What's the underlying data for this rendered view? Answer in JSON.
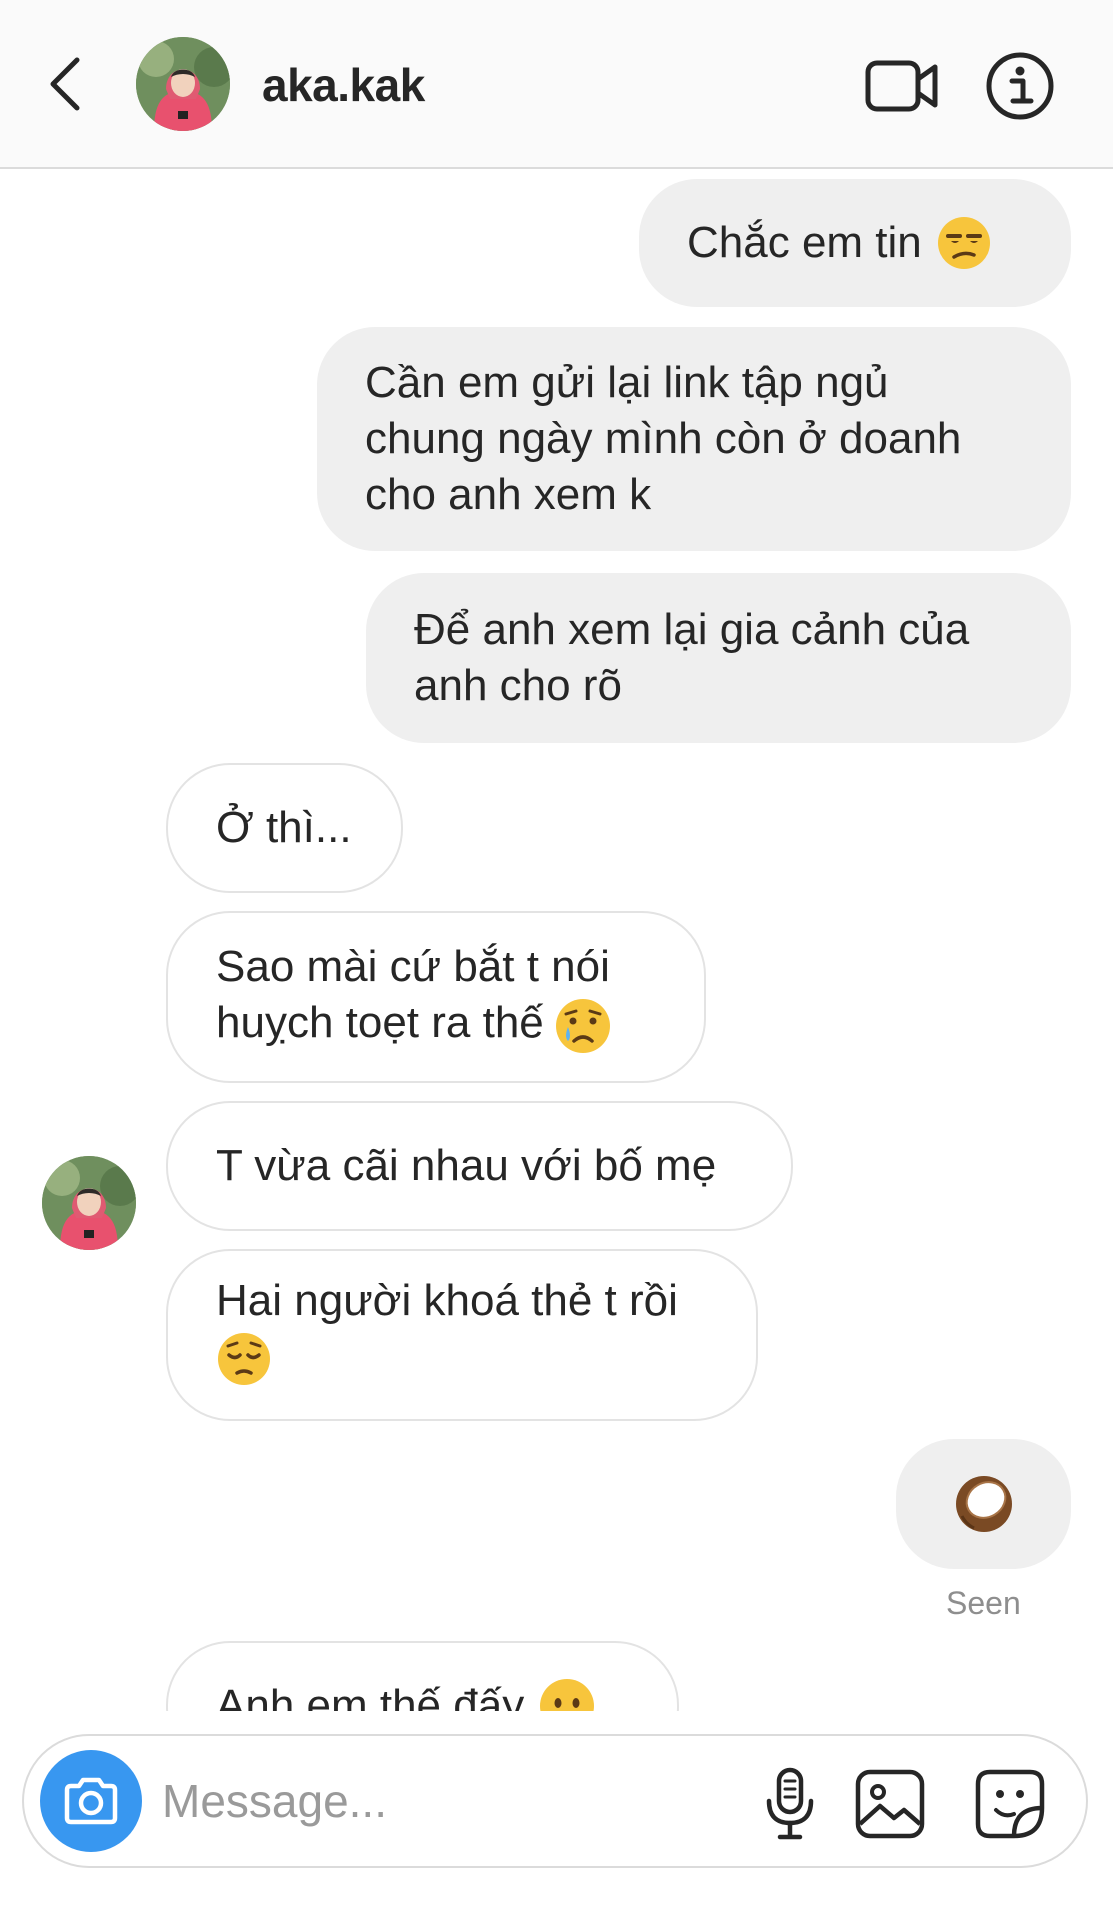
{
  "header": {
    "username": "aka.kak",
    "icons": {
      "back": "chevron-left-icon",
      "video": "video-camera-icon",
      "info": "info-icon"
    }
  },
  "messages": [
    {
      "direction": "outgoing",
      "text": "Chắc em tin",
      "emoji": "unamused-face"
    },
    {
      "direction": "outgoing",
      "text": "Cần em gửi lại link tập ngủ\nchung ngày mình còn ở doanh\ncho anh xem k"
    },
    {
      "direction": "outgoing",
      "text": "Để anh xem lại gia cảnh của\nanh cho rõ"
    },
    {
      "direction": "incoming",
      "text": "Ở thì..."
    },
    {
      "direction": "incoming",
      "text": "Sao mài cứ bắt t nói\nhuỵch toẹt ra thế",
      "emoji": "crying-face"
    },
    {
      "direction": "incoming",
      "text": "T vừa cãi nhau với bố mẹ"
    },
    {
      "direction": "incoming",
      "text": "Hai người khoá thẻ t rồi",
      "emoji": "pensive-face"
    },
    {
      "direction": "outgoing",
      "text": "",
      "emoji": "coconut"
    },
    {
      "direction": "incoming",
      "text": "Anh em thế đấy",
      "emoji": "face-without-mouth"
    }
  ],
  "status": {
    "seen": "Seen"
  },
  "composer": {
    "placeholder": "Message...",
    "value": "",
    "icons": {
      "camera": "camera-icon",
      "mic": "microphone-icon",
      "gallery": "gallery-icon",
      "sticker": "sticker-icon"
    }
  },
  "colors": {
    "outgoing_bubble": "#efefef",
    "incoming_border": "#e3e3e3",
    "camera_button": "#3897f0",
    "text": "#262626",
    "secondary_text": "#8e8e8e"
  }
}
